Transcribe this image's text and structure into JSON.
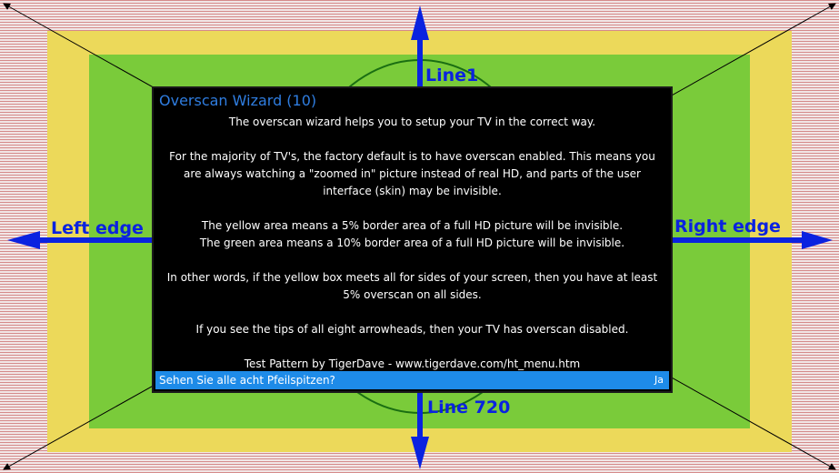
{
  "labels": {
    "top": "Line1",
    "bottom": "Line 720",
    "left": "Left edge",
    "right": "Right edge"
  },
  "dialog": {
    "title": "Overscan Wizard (10)",
    "paragraphs": [
      "The overscan wizard helps you to setup your TV in the correct way.",
      "For the majority of TV's, the factory default is to have overscan enabled. This means you are always watching a \"zoomed in\" picture instead of real HD, and parts of the user interface (skin) may be invisible.",
      "The yellow area means a 5% border area of a full HD picture will be invisible.\nThe green area means a 10% border area of a full HD picture will be invisible.",
      "In other words, if the yellow box meets all for sides of your screen, then you have at least 5% overscan on all sides.",
      "If you see the tips of all eight arrowheads, then your TV has overscan disabled.",
      "Test Pattern by TigerDave - www.tigerdave.com/ht_menu.htm"
    ],
    "question": "Sehen Sie alle acht Pfeilspitzen?",
    "answer": "Ja"
  },
  "colors": {
    "stripe_red": "#d58a8a",
    "yellow": "#ecd95a",
    "green": "#7acb3a",
    "arrow_blue": "#0a22e0",
    "dialog_bg": "#000000",
    "title_blue": "#2f7de0",
    "question_bar": "#1e8be8"
  }
}
